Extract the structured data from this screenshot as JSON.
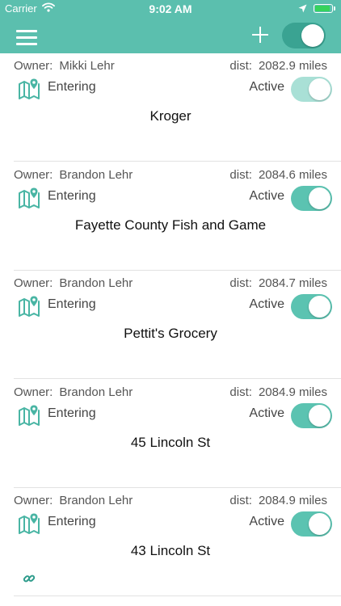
{
  "status_bar": {
    "carrier": "Carrier",
    "time": "9:02 AM"
  },
  "nav": {
    "menu_icon": "hamburger-menu-icon",
    "add_icon": "plus-icon",
    "master_toggle_on": true
  },
  "colors": {
    "brand": "#5bbfae",
    "toggle_on": "#5bc3b1",
    "toggle_dim": "#a9e0d6",
    "icon": "#49b5a4"
  },
  "labels": {
    "owner": "Owner:",
    "dist": "dist:"
  },
  "geofences": [
    {
      "owner": "Mikki Lehr",
      "distance": "2082.9 miles",
      "trigger": "Entering",
      "status": "Active",
      "enabled": true,
      "dimmed": true,
      "place": "Kroger"
    },
    {
      "owner": "Brandon Lehr",
      "distance": "2084.6 miles",
      "trigger": "Entering",
      "status": "Active",
      "enabled": true,
      "dimmed": false,
      "place": "Fayette County Fish and Game"
    },
    {
      "owner": "Brandon Lehr",
      "distance": "2084.7 miles",
      "trigger": "Entering",
      "status": "Active",
      "enabled": true,
      "dimmed": false,
      "place": "Pettit's Grocery"
    },
    {
      "owner": "Brandon Lehr",
      "distance": "2084.9 miles",
      "trigger": "Entering",
      "status": "Active",
      "enabled": true,
      "dimmed": false,
      "place": "45 Lincoln St"
    },
    {
      "owner": "Brandon Lehr",
      "distance": "2084.9 miles",
      "trigger": "Entering",
      "status": "Active",
      "enabled": true,
      "dimmed": false,
      "place": "43 Lincoln St",
      "link_icon": "link-icon"
    }
  ]
}
